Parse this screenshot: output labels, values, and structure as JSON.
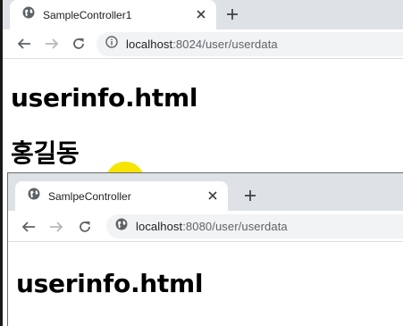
{
  "window_back": {
    "tab": {
      "title": "SampleController1",
      "icon": "globe-icon"
    },
    "toolbar": {
      "url_host": "localhost",
      "url_rest": ":8024/user/userdata",
      "security_icon": "info-icon"
    },
    "page": {
      "heading": "userinfo.html",
      "name": "홍길동"
    }
  },
  "window_front": {
    "tab": {
      "title": "SamlpeController",
      "icon": "globe-icon"
    },
    "toolbar": {
      "url_host": "localhost",
      "url_rest": ":8080/user/userdata",
      "security_icon": "globe-icon"
    },
    "page": {
      "heading": "userinfo.html"
    }
  },
  "colors": {
    "tabstrip": "#dee1e6",
    "omnibox": "#f1f3f4",
    "cursor_highlight": "#f7e400"
  }
}
